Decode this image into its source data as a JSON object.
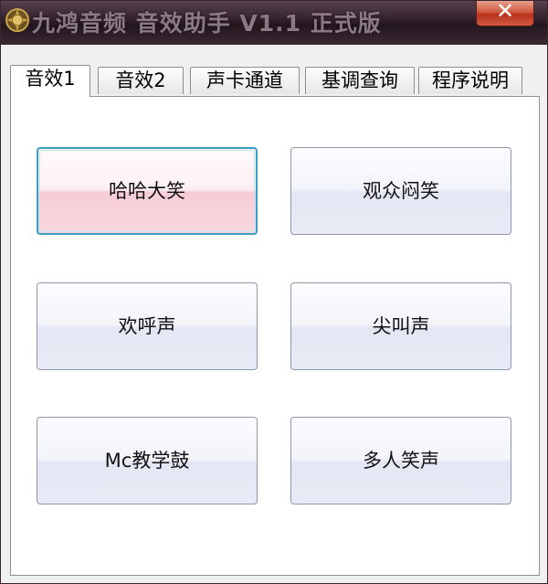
{
  "window": {
    "title": "九鸿音频 音效助手 V1.1 正式版",
    "close_label": "✕"
  },
  "tabs": [
    {
      "label": "音效1",
      "active": true
    },
    {
      "label": "音效2",
      "active": false
    },
    {
      "label": "声卡通道",
      "active": false
    },
    {
      "label": "基调查询",
      "active": false
    },
    {
      "label": "程序说明",
      "active": false
    }
  ],
  "buttons": [
    {
      "label": "哈哈大笑",
      "focused": true
    },
    {
      "label": "观众闷笑",
      "focused": false
    },
    {
      "label": "欢呼声",
      "focused": false
    },
    {
      "label": "尖叫声",
      "focused": false
    },
    {
      "label": "Mc教学鼓",
      "focused": false
    },
    {
      "label": "多人笑声",
      "focused": false
    }
  ],
  "icons": {
    "app": "app-logo-icon",
    "close": "close-icon"
  },
  "colors": {
    "titlebar": "#2f1f28",
    "close_button": "#c8442a",
    "focus_border": "#3d9ec2",
    "focused_fill": "#f6ccd6",
    "button_fill": "#e3e6f3"
  }
}
